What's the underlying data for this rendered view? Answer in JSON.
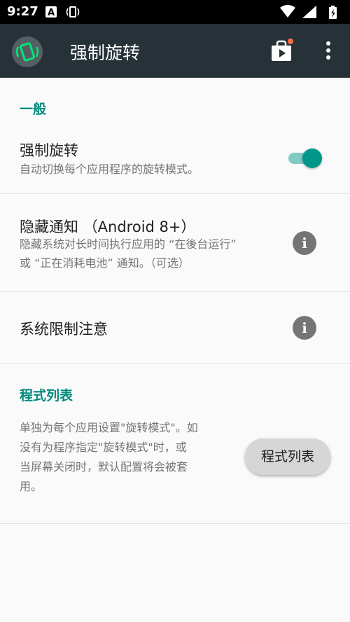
{
  "status_bar": {
    "time": "9:27",
    "left_icons": [
      "autofill-a-icon",
      "rotate-icon"
    ],
    "right_icons": [
      "wifi-icon",
      "signal-icon",
      "battery-charging-icon"
    ]
  },
  "app_bar": {
    "title": "强制旋转",
    "app_icon": "rotate-phone-icon",
    "actions": [
      "play-store-icon",
      "more-vert-icon"
    ]
  },
  "sections": {
    "general": {
      "header": "一般",
      "force_rotation": {
        "title": "强制旋转",
        "summary": "自动切换每个应用程序的旋转模式。",
        "enabled": true
      },
      "hide_notification": {
        "title": "隐藏通知 （Android 8+）",
        "summary_line1": "隐藏系统对长时间执行应用的 “在後台运行”",
        "summary_line2": "或 “正在消耗电池” 通知。（可选）"
      },
      "system_restriction": {
        "title": "系统限制注意"
      }
    },
    "app_list": {
      "header": "程式列表",
      "description_lines": [
        "单独为每个应用设置\"旋转模式\"。如",
        "没有为程序指定\"旋转模式\"时，或",
        "当屏幕关闭时，默认配置将会被套",
        "用。"
      ],
      "button_label": "程式列表"
    }
  },
  "colors": {
    "app_bar": "#263238",
    "accent": "#00897b",
    "switch_thumb": "#009688",
    "switch_track": "#80cbc4",
    "notification_dot": "#ff7043"
  }
}
